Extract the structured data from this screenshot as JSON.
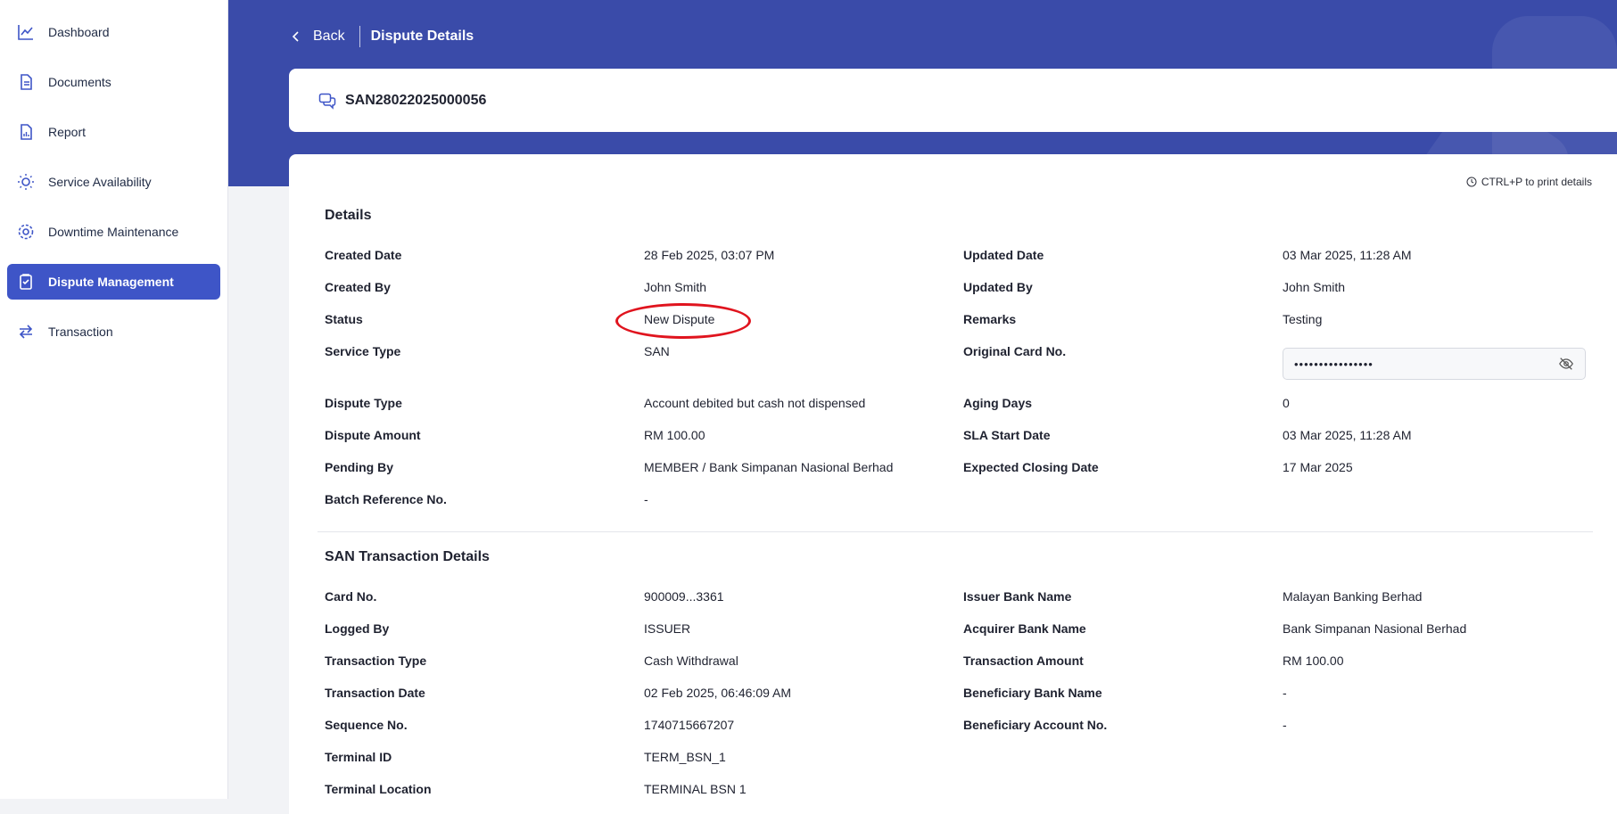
{
  "sidebar": {
    "items": [
      {
        "label": "Dashboard",
        "icon": "dashboard-chart-icon"
      },
      {
        "label": "Documents",
        "icon": "document-icon"
      },
      {
        "label": "Report",
        "icon": "report-icon"
      },
      {
        "label": "Service Availability",
        "icon": "lightbulb-icon"
      },
      {
        "label": "Downtime Maintenance",
        "icon": "gear-icon"
      },
      {
        "label": "Dispute Management",
        "icon": "clipboard-icon",
        "active": true
      },
      {
        "label": "Transaction",
        "icon": "transfer-arrows-icon"
      }
    ]
  },
  "topbar": {
    "back_label": "Back",
    "title": "Dispute Details"
  },
  "header": {
    "reference": "SAN28022025000056"
  },
  "main": {
    "print_hint": "CTRL+P to print details",
    "details": {
      "title": "Details",
      "rows": [
        {
          "l1": "Created Date",
          "v1": "28 Feb 2025, 03:07 PM",
          "l2": "Updated Date",
          "v2": "03 Mar 2025, 11:28 AM"
        },
        {
          "l1": "Created By",
          "v1": "John Smith",
          "l2": "Updated By",
          "v2": "John Smith"
        },
        {
          "l1": "Status",
          "v1": "New Dispute",
          "l2": "Remarks",
          "v2": "Testing"
        },
        {
          "l1": "Service Type",
          "v1": "SAN",
          "l2": "Original Card No.",
          "v2": ""
        },
        {
          "l1": "Dispute Type",
          "v1": "Account debited but cash not dispensed",
          "l2": "Aging Days",
          "v2": "0"
        },
        {
          "l1": "Dispute Amount",
          "v1": "RM 100.00",
          "l2": "SLA Start Date",
          "v2": "03 Mar 2025, 11:28 AM"
        },
        {
          "l1": "Pending By",
          "v1": "MEMBER / Bank Simpanan Nasional Berhad",
          "l2": "Expected Closing Date",
          "v2": "17 Mar 2025"
        },
        {
          "l1": "Batch Reference No.",
          "v1": "-",
          "l2": "",
          "v2": ""
        }
      ],
      "original_card_masked": "••••••••••••••••"
    },
    "transaction": {
      "title": "SAN Transaction Details",
      "rows": [
        {
          "l1": "Card No.",
          "v1": "900009...3361",
          "l2": "Issuer Bank Name",
          "v2": "Malayan Banking Berhad"
        },
        {
          "l1": "Logged By",
          "v1": "ISSUER",
          "l2": "Acquirer Bank Name",
          "v2": "Bank Simpanan Nasional Berhad"
        },
        {
          "l1": "Transaction Type",
          "v1": "Cash Withdrawal",
          "l2": "Transaction Amount",
          "v2": "RM 100.00"
        },
        {
          "l1": "Transaction Date",
          "v1": "02 Feb 2025, 06:46:09 AM",
          "l2": "Beneficiary Bank Name",
          "v2": "-"
        },
        {
          "l1": "Sequence No.",
          "v1": "1740715667207",
          "l2": "Beneficiary Account No.",
          "v2": "-"
        },
        {
          "l1": "Terminal ID",
          "v1": "TERM_BSN_1",
          "l2": "",
          "v2": ""
        },
        {
          "l1": "Terminal Location",
          "v1": "TERMINAL BSN 1",
          "l2": "",
          "v2": ""
        }
      ]
    }
  },
  "colors": {
    "brand": "#3a4ba9",
    "active_nav": "#3e55c7",
    "annotation": "#e0141e"
  }
}
